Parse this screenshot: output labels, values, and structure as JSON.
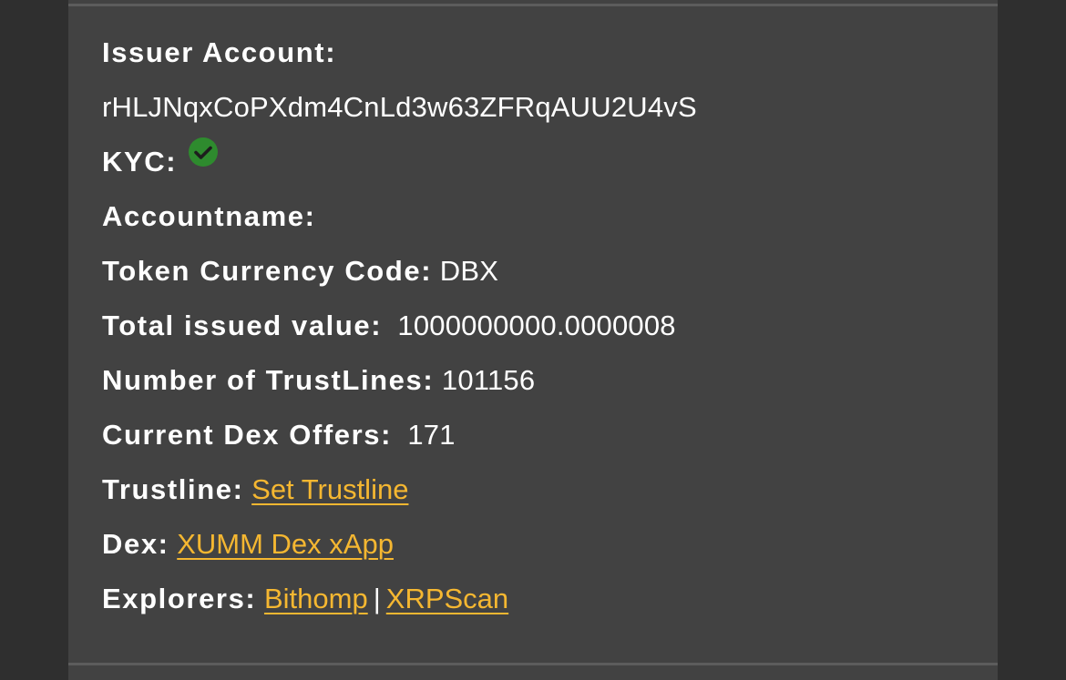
{
  "issuer": {
    "label": "Issuer Account:",
    "address": "rHLJNqxCoPXdm4CnLd3w63ZFRqAUU2U4vS"
  },
  "kyc": {
    "label": "KYC:",
    "status_icon": "check-circle-icon",
    "status_color": "#2e8b2e"
  },
  "accountname": {
    "label": "Accountname:",
    "value": ""
  },
  "currency": {
    "label": "Token Currency Code:",
    "value": "DBX"
  },
  "issued": {
    "label": "Total issued value:",
    "value": "1000000000.0000008"
  },
  "trustlines": {
    "label": "Number of TrustLines:",
    "value": "101156"
  },
  "dex_offers": {
    "label": "Current Dex Offers:",
    "value": "171"
  },
  "trustline": {
    "label": "Trustline:",
    "link": "Set Trustline"
  },
  "dex": {
    "label": "Dex:",
    "link": "XUMM Dex xApp"
  },
  "explorers": {
    "label": "Explorers:",
    "links": [
      "Bithomp",
      "XRPScan"
    ],
    "separator": "|"
  },
  "colors": {
    "link": "#f5b731",
    "text": "#ffffff",
    "card_bg": "#424242",
    "page_bg": "#333333"
  }
}
